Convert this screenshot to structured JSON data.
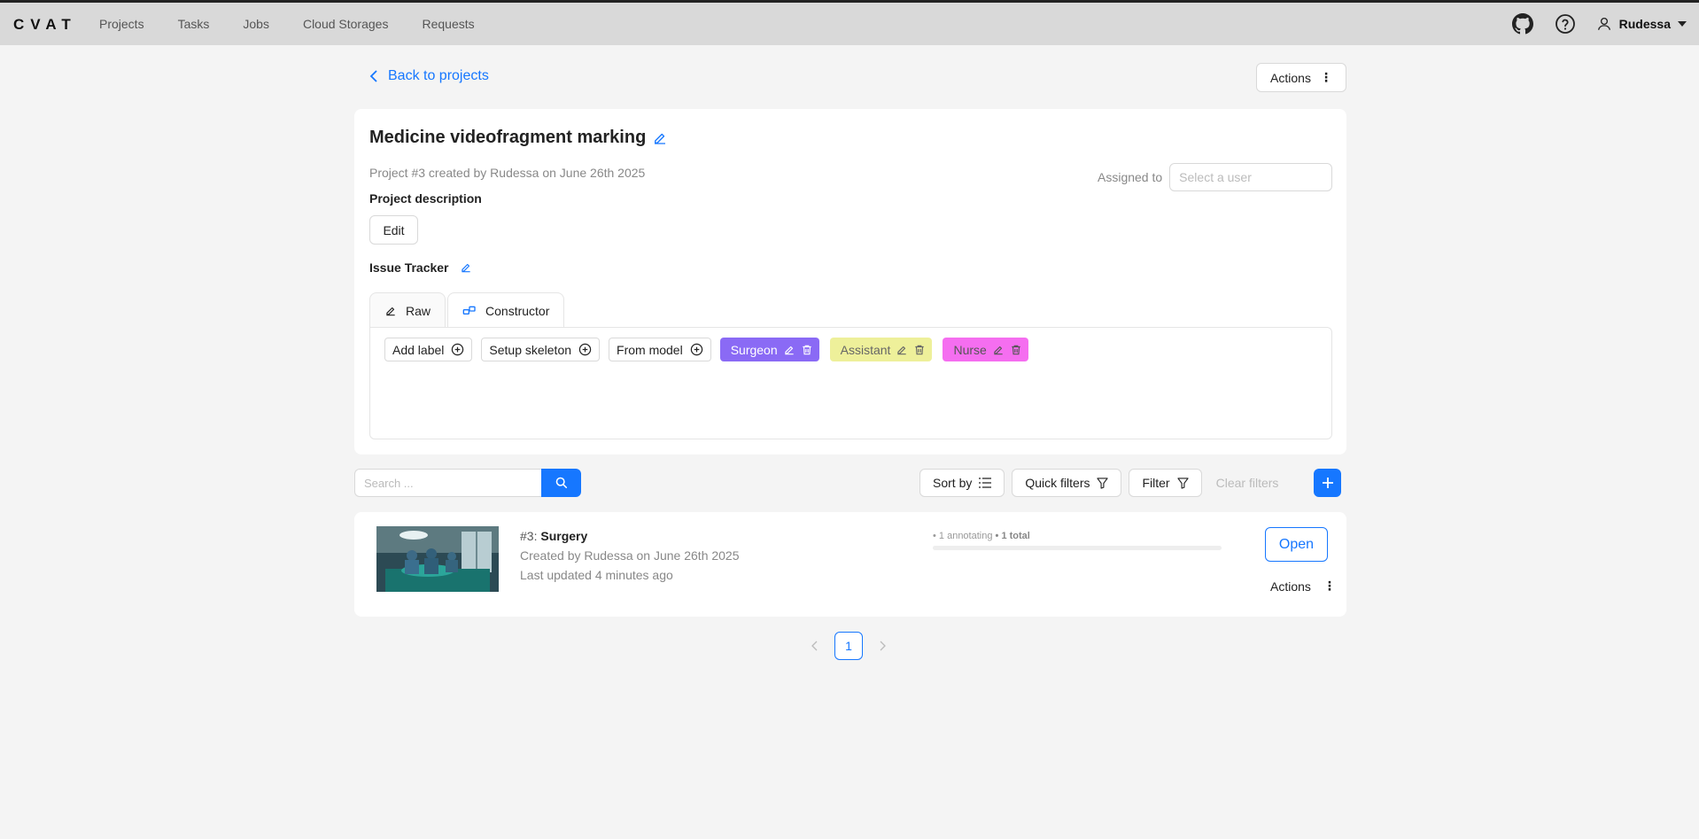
{
  "header": {
    "logo": "CVAT",
    "nav": [
      "Projects",
      "Tasks",
      "Jobs",
      "Cloud Storages",
      "Requests"
    ],
    "user": "Rudessa"
  },
  "page": {
    "back_label": "Back to projects",
    "actions_label": "Actions"
  },
  "project": {
    "title": "Medicine videofragment marking",
    "meta": "Project #3 created by Rudessa on June 26th 2025",
    "assigned_label": "Assigned to",
    "assigned_placeholder": "Select a user",
    "description_label": "Project description",
    "edit_label": "Edit",
    "issue_tracker_label": "Issue Tracker",
    "tabs": [
      "Raw",
      "Constructor"
    ],
    "active_tab": "Constructor",
    "tools": [
      "Add label",
      "Setup skeleton",
      "From model"
    ],
    "labels": [
      {
        "name": "Surgeon",
        "color": "#8a6af5",
        "text_color": "#ffffff"
      },
      {
        "name": "Assistant",
        "color": "#eef09a",
        "text_color": "#666666"
      },
      {
        "name": "Nurse",
        "color": "#f56ef0",
        "text_color": "#555555"
      }
    ]
  },
  "toolbar": {
    "search_placeholder": "Search ...",
    "sort_label": "Sort by",
    "quick_filters_label": "Quick filters",
    "filter_label": "Filter",
    "clear_filters_label": "Clear filters"
  },
  "task": {
    "number": "#3:",
    "name": "Surgery",
    "created": "Created by Rudessa on June 26th 2025",
    "updated": "Last updated 4 minutes ago",
    "progress_annotating": "• 1 annotating",
    "progress_total": "• 1 total",
    "progress_fraction": 0,
    "open_label": "Open",
    "actions_label": "Actions"
  },
  "pagination": {
    "current": "1"
  },
  "colors": {
    "accent": "#1677ff"
  }
}
